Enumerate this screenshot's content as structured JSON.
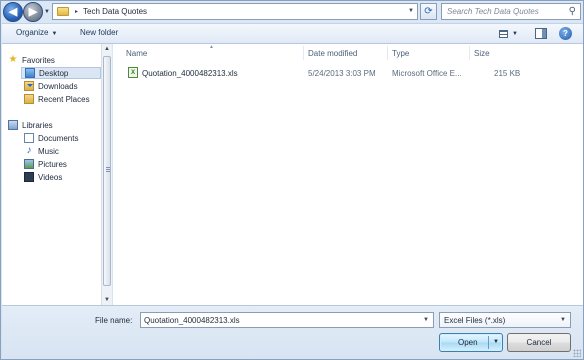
{
  "address_bar": {
    "path_separator": "▸",
    "current_folder": "Tech Data Quotes",
    "dropdown_glyph": "▾"
  },
  "search": {
    "placeholder": "Search Tech Data Quotes"
  },
  "toolbar": {
    "organize_label": "Organize",
    "new_folder_label": "New folder"
  },
  "nav_pane": {
    "favorites_label": "Favorites",
    "favorites": [
      {
        "label": "Desktop",
        "icon": "desktop-icon",
        "selected": true
      },
      {
        "label": "Downloads",
        "icon": "downloads-icon"
      },
      {
        "label": "Recent Places",
        "icon": "recent-places-icon"
      }
    ],
    "libraries_label": "Libraries",
    "libraries": [
      {
        "label": "Documents",
        "icon": "documents-icon"
      },
      {
        "label": "Music",
        "icon": "music-icon"
      },
      {
        "label": "Pictures",
        "icon": "pictures-icon"
      },
      {
        "label": "Videos",
        "icon": "videos-icon"
      }
    ]
  },
  "file_list": {
    "columns": {
      "name": "Name",
      "date": "Date modified",
      "type": "Type",
      "size": "Size"
    },
    "rows": [
      {
        "name": "Quotation_4000482313.xls",
        "date": "5/24/2013 3:03 PM",
        "type": "Microsoft Office E...",
        "size": "215 KB",
        "icon": "excel-file-icon"
      }
    ]
  },
  "bottom": {
    "file_name_label": "File name:",
    "file_name_value": "Quotation_4000482313.xls",
    "filter_value": "Excel Files (*.xls)",
    "open_label": "Open",
    "cancel_label": "Cancel"
  },
  "colors": {
    "accent": "#3c7fb1",
    "background": "#dfe9f5",
    "text": "#1e395b"
  }
}
